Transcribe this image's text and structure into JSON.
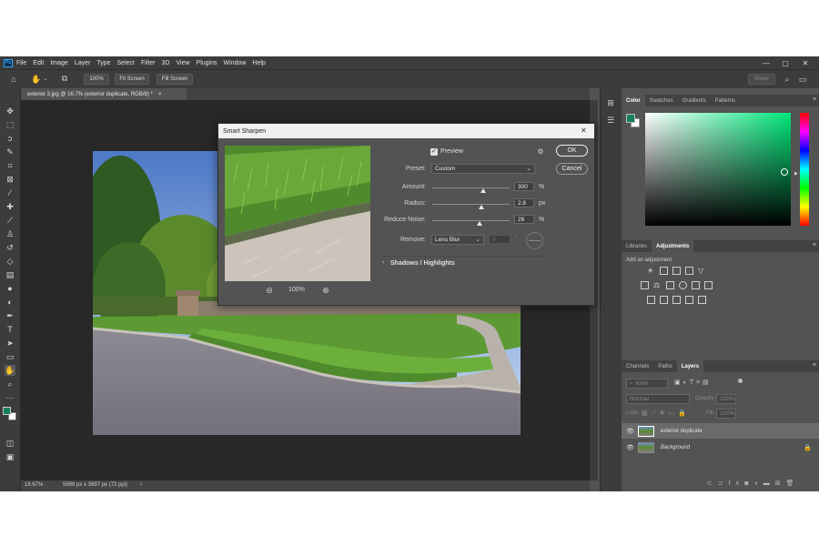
{
  "app": {
    "logo": "Ps"
  },
  "menu": [
    "File",
    "Edit",
    "Image",
    "Layer",
    "Type",
    "Select",
    "Filter",
    "3D",
    "View",
    "Plugins",
    "Window",
    "Help"
  ],
  "options": {
    "zoom": "100%",
    "fit_screen": "Fit Screen",
    "fill_screen": "Fill Screen",
    "share": "Share"
  },
  "document": {
    "tab_title": "exterior 3.jpg @ 16.7% (exterior duplicate, RGB/8) *",
    "close": "×"
  },
  "status": {
    "zoom": "16.67%",
    "info": "5998 px x 3997 px (72 ppi)",
    "arrow": "›"
  },
  "dialog": {
    "title": "Smart Sharpen",
    "close": "✕",
    "preview_label": "Preview",
    "preview_checked": true,
    "ok": "OK",
    "cancel": "Cancel",
    "preset_label": "Preset:",
    "preset_value": "Custom",
    "amount_label": "Amount:",
    "amount_value": "300",
    "amount_unit": "%",
    "amount_fraction": 0.3,
    "radius_label": "Radius:",
    "radius_value": "2.8",
    "radius_unit": "px",
    "radius_fraction": 0.28,
    "noise_label": "Reduce Noise:",
    "noise_value": "26",
    "noise_unit": "%",
    "noise_fraction": 0.26,
    "remove_label": "Remove:",
    "remove_value": "Lens Blur",
    "remove_angle": "0",
    "angle_unit": "°",
    "shadows_highlights": "Shadows / Highlights",
    "preview_zoom": "100%"
  },
  "color_panel": {
    "tabs": [
      "Color",
      "Swatches",
      "Gradients",
      "Patterns"
    ],
    "active": "Color",
    "hue_color": "#00ff80",
    "fg": "#16805a",
    "bg": "#ffffff"
  },
  "adjust_panel": {
    "tabs": [
      "Libraries",
      "Adjustments"
    ],
    "active": "Adjustments",
    "hint": "Add an adjustment"
  },
  "layers_panel": {
    "tabs": [
      "Channels",
      "Paths",
      "Layers"
    ],
    "active": "Layers",
    "kind_placeholder": "Kind",
    "blend_mode": "Normal",
    "opacity_label": "Opacity:",
    "opacity_value": "100%",
    "lock_label": "Lock:",
    "fill_label": "Fill:",
    "fill_value": "100%",
    "layers": [
      {
        "name": "exterior duplicate",
        "selected": true,
        "italic": false,
        "locked": false
      },
      {
        "name": "Background",
        "selected": false,
        "italic": true,
        "locked": true
      }
    ]
  }
}
